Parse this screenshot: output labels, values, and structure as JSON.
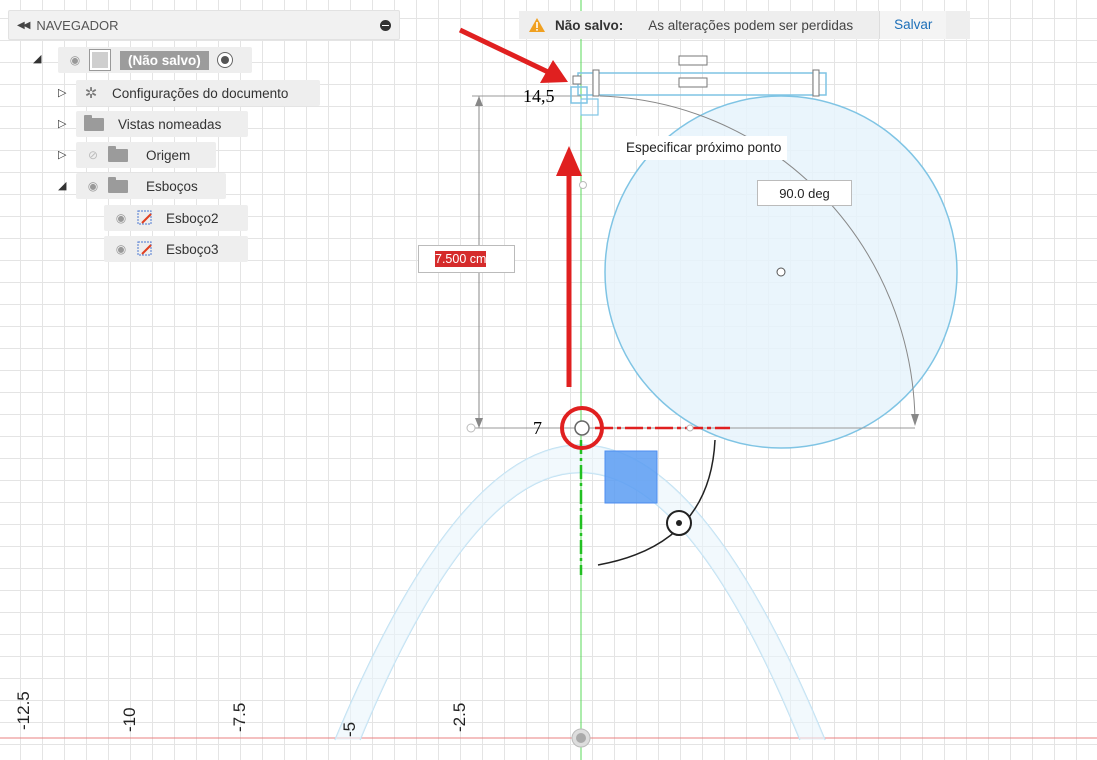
{
  "navigator": {
    "title": "NAVEGADOR",
    "root_label": "(Não salvo)",
    "items": [
      {
        "label": "Configurações do documento"
      },
      {
        "label": "Vistas nomeadas"
      },
      {
        "label": "Origem"
      },
      {
        "label": "Esboços"
      },
      {
        "label": "Esboço2"
      },
      {
        "label": "Esboço3"
      }
    ]
  },
  "unsaved_bar": {
    "label": "Não salvo:",
    "message": "As alterações podem ser perdidas",
    "save": "Salvar"
  },
  "canvas": {
    "tooltip": "Especificar próximo ponto",
    "angle_value": "90.0 deg",
    "dimension_value": "7.500 cm",
    "annotation_top": "14,5",
    "annotation_bottom": "7",
    "axis_labels": [
      "-12.5",
      "-10",
      "-7.5",
      "-5",
      "-2.5"
    ]
  },
  "colors": {
    "annotation_red": "#e02020",
    "sketch_blue": "#7fc4e4",
    "fill_blue": "#d7edf8",
    "selection_blue": "#4d8ef0",
    "y_axis_green": "#2ecc40",
    "x_axis_red": "#e06060",
    "link_blue": "#1d6fb8"
  }
}
